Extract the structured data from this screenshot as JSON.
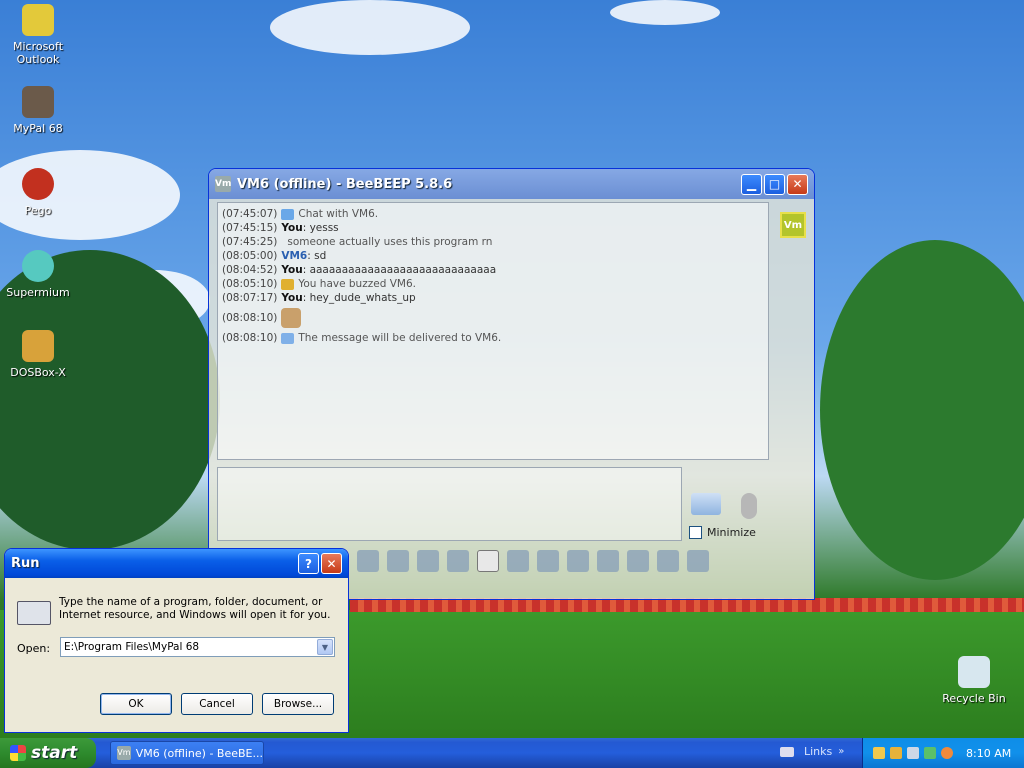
{
  "desktop": {
    "icons": [
      {
        "label": "Microsoft Outlook"
      },
      {
        "label": "MyPal 68"
      },
      {
        "label": "Pego"
      },
      {
        "label": "Supermium"
      },
      {
        "label": "DOSBox-X"
      },
      {
        "label": "Recycle Bin"
      }
    ]
  },
  "beebeep": {
    "app_icon": "Vm",
    "title": "VM6 (offline) - BeeBEEP 5.8.6",
    "messages": [
      {
        "time": "(07:45:07)",
        "sender": "",
        "text": "Chat with VM6.",
        "icon": "chat-bubble-icon"
      },
      {
        "time": "(07:45:15)",
        "sender": "You",
        "text": ": yesss"
      },
      {
        "time": "(07:45:25)",
        "sender": "",
        "text": "someone actually uses this program rn"
      },
      {
        "time": "(08:05:00)",
        "sender": "VM6",
        "text": ": sd"
      },
      {
        "time": "(08:04:52)",
        "sender": "You",
        "text": ": aaaaaaaaaaaaaaaaaaaaaaaaaaaaa"
      },
      {
        "time": "(08:05:10)",
        "sender": "",
        "text": "You have buzzed VM6.",
        "icon": "bell-icon"
      },
      {
        "time": "(08:07:17)",
        "sender": "You",
        "text": ": hey_dude_whats_up"
      },
      {
        "time": "(08:08:10)",
        "sender": "",
        "text": "",
        "icon": "thumbs-up-icon"
      },
      {
        "time": "(08:08:10)",
        "sender": "",
        "text": "The message will be delivered to VM6.",
        "icon": "envelope-icon"
      }
    ],
    "user_badge": "Vm",
    "minimize_label": "Minimize",
    "minimize_checked": false
  },
  "run": {
    "title": "Run",
    "help_label": "?",
    "description": "Type the name of a program, folder, document, or Internet resource, and Windows will open it for you.",
    "open_label": "Open:",
    "open_value": "E:\\Program Files\\MyPal 68",
    "ok_label": "OK",
    "cancel_label": "Cancel",
    "browse_label": "Browse..."
  },
  "taskbar": {
    "start_label": "start",
    "task_title": "VM6 (offline) - BeeBE...",
    "task_icon": "Vm",
    "links_label": "Links",
    "links_chevron": "»",
    "clock": "8:10 AM"
  }
}
